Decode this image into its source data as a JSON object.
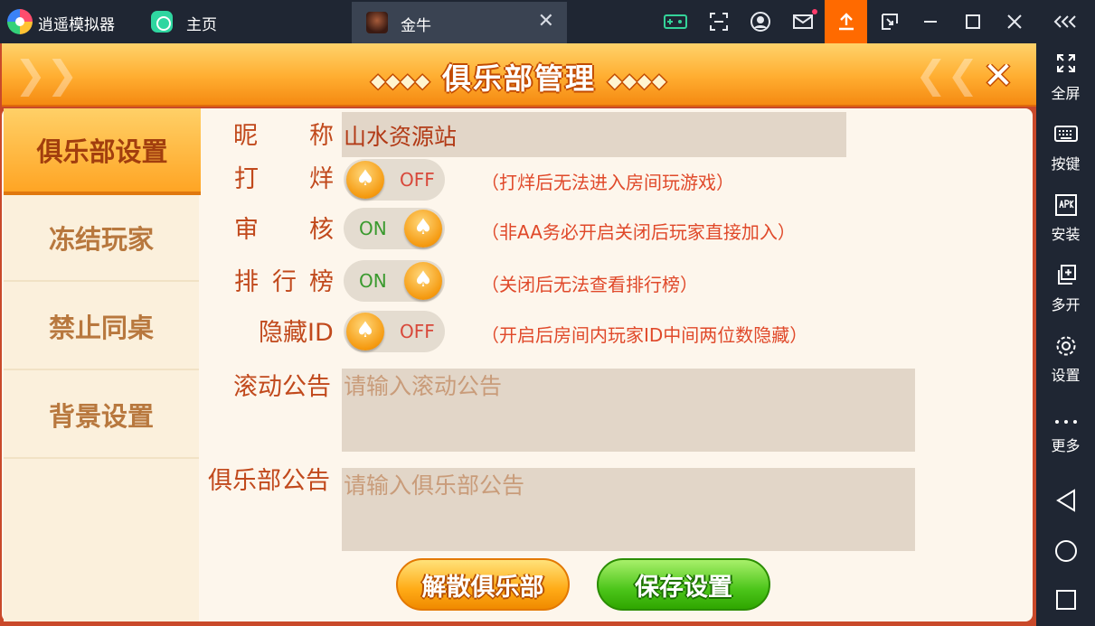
{
  "emulator": {
    "app_name": "逍遥模拟器",
    "home_tab": "主页",
    "active_tab": "金牛",
    "sidebar": [
      {
        "icon": "fullscreen-icon",
        "label": "全屏"
      },
      {
        "icon": "keyboard-icon",
        "label": "按键"
      },
      {
        "icon": "apk-icon",
        "label": "安装"
      },
      {
        "icon": "multi-instance-icon",
        "label": "多开"
      },
      {
        "icon": "settings-icon",
        "label": "设置"
      },
      {
        "icon": "more-icon",
        "label": "更多"
      }
    ],
    "nav_buttons": [
      "back-icon",
      "home-circle-icon",
      "recent-apps-icon"
    ],
    "colors": {
      "titlebar": "#1f2633",
      "upload_accent": "#ff6a00"
    }
  },
  "game": {
    "title": "俱乐部管理",
    "menu": [
      {
        "label": "俱乐部设置",
        "active": true
      },
      {
        "label": "冻结玩家",
        "active": false
      },
      {
        "label": "禁止同桌",
        "active": false
      },
      {
        "label": "背景设置",
        "active": false
      }
    ],
    "form": {
      "nickname": {
        "label_a": "昵",
        "label_b": "称",
        "value": "山水资源站"
      },
      "toggles": [
        {
          "label_chars": [
            "打",
            "烊"
          ],
          "state": "OFF",
          "hint": "（打烊后无法进入房间玩游戏）"
        },
        {
          "label_chars": [
            "审",
            "核"
          ],
          "state": "ON",
          "hint": "（非AA务必开启关闭后玩家直接加入）"
        },
        {
          "label_chars": [
            "排",
            "行",
            "榜"
          ],
          "state": "ON",
          "hint": "（关闭后无法查看排行榜）"
        },
        {
          "label_text": "隐藏ID",
          "state": "OFF",
          "hint": "（开启后房间内玩家ID中间两位数隐藏）"
        }
      ],
      "scroll_notice": {
        "label": "滚动公告",
        "placeholder": "请输入滚动公告"
      },
      "club_notice": {
        "label": "俱乐部公告",
        "placeholder": "请输入俱乐部公告"
      }
    },
    "buttons": {
      "dissolve": "解散俱乐部",
      "save": "保存设置"
    },
    "colors": {
      "header": "#ffad30",
      "label": "#c1491c",
      "hint": "#e0492a",
      "on_text": "#3a9a2e",
      "off_text": "#d8483a"
    }
  }
}
